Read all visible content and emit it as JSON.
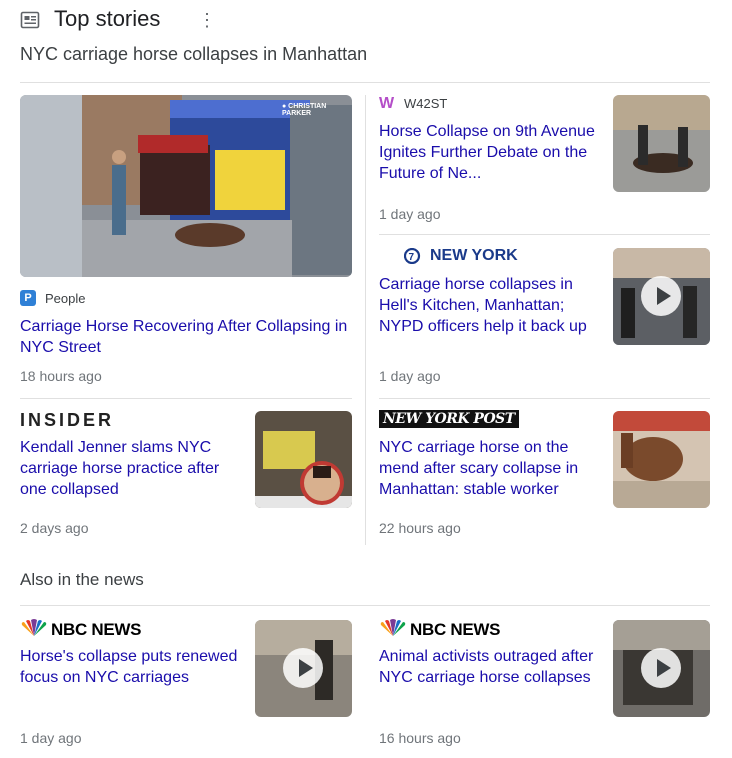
{
  "header": {
    "title": "Top stories",
    "menu_glyph": "⋮"
  },
  "query": "NYC carriage horse collapses in Manhattan",
  "stories": [
    {
      "source": "People",
      "source_logo": "P",
      "headline": "Carriage Horse Recovering After Collapsing in NYC Street",
      "time": "18 hours ago",
      "thumb_caption": "● CHRISTIAN PARKER"
    },
    {
      "source": "W42ST",
      "source_logo": "W",
      "headline": "Horse Collapse on 9th Avenue Ignites Further Debate on the Future of Ne...",
      "time": "1 day ago"
    },
    {
      "source": "NEW YORK",
      "source_logo": "7",
      "headline": "Carriage horse collapses in Hell's Kitchen, Manhattan; NYPD officers help it back up",
      "time": "1 day ago"
    },
    {
      "source": "INSIDER",
      "headline": "Kendall Jenner slams NYC carriage horse practice after one collapsed",
      "time": "2 days ago"
    },
    {
      "source": "NEW YORK POST",
      "headline": "NYC carriage horse on the mend after scary collapse in Manhattan: stable worker",
      "time": "22 hours ago"
    }
  ],
  "also_in_news": {
    "title": "Also in the news",
    "items": [
      {
        "source": "NBC NEWS",
        "headline": "Horse's collapse puts renewed focus on NYC carriages",
        "time": "1 day ago"
      },
      {
        "source": "NBC NEWS",
        "headline": "Animal activists outraged after NYC carriage horse collapses",
        "time": "16 hours ago"
      }
    ]
  },
  "colors": {
    "link": "#1a0dab",
    "meta": "#70757a",
    "divider": "#e0e0e0",
    "people_badge": "#2f80d6",
    "w42st": "#b44ec8",
    "abc7": "#1a3a8a"
  }
}
